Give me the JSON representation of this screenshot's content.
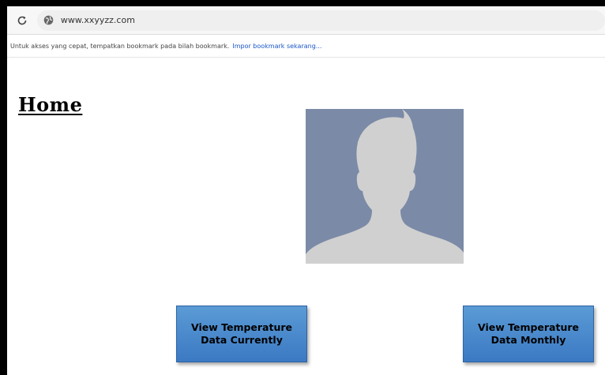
{
  "browser": {
    "url": "www.xxyyzz.com",
    "bookmark_hint": "Untuk akses yang cepat, tempatkan bookmark pada bilah bookmark.",
    "bookmark_import_link": "Impor bookmark sekarang..."
  },
  "page": {
    "title": "Home",
    "buttons": {
      "current": "View Temperature Data Currently",
      "monthly": "View Temperature Data Monthly"
    }
  },
  "icons": {
    "reload": "reload-icon",
    "globe": "globe-icon",
    "avatar": "default-profile-avatar"
  },
  "colors": {
    "avatar_bg": "#7b8aa6",
    "avatar_figure": "#d0d0d0",
    "button_bg": "#4a8ad0",
    "link": "#1a56c7"
  }
}
